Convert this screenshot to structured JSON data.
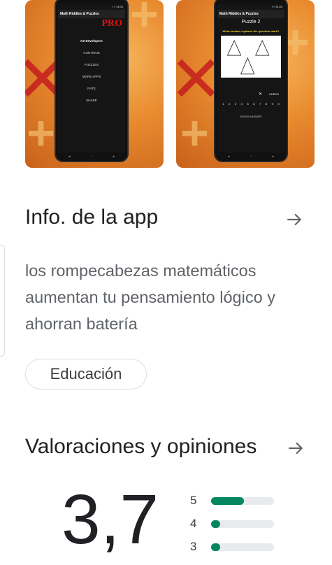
{
  "screenshots": {
    "shot1": {
      "app_title": "Math Riddles & Puzzles",
      "pro_label": "PRO",
      "developer": "KZ Developers",
      "menu": [
        "CONTINUE",
        "PUZZLES",
        "MORE APPS",
        "RATE",
        "SHARE"
      ]
    },
    "shot2": {
      "app_title": "Math Riddles & Puzzles",
      "puzzle_label": "Puzzle  2",
      "question": "What number replaces the question mark?",
      "check_label": "CHECK",
      "digits": [
        "1",
        "2",
        "3",
        "4",
        "5",
        "6",
        "7",
        "8",
        "9",
        "0"
      ],
      "show_answer": "SHOW ANSWER"
    }
  },
  "app_info": {
    "title": "Info. de la app",
    "description": "los rompecabezas matemáticos aumentan tu pensamiento lógico y ahorran batería",
    "category_chip": "Educación"
  },
  "ratings": {
    "title": "Valoraciones y opiniones",
    "average": "3,7",
    "bars": [
      {
        "stars": "5",
        "fraction": 0.52
      },
      {
        "stars": "4",
        "fraction": 0.14
      },
      {
        "stars": "3",
        "fraction": 0.14
      }
    ]
  },
  "colors": {
    "accent": "#01875f",
    "track": "#e8eaed",
    "text": "#202124",
    "muted": "#5f6368"
  }
}
